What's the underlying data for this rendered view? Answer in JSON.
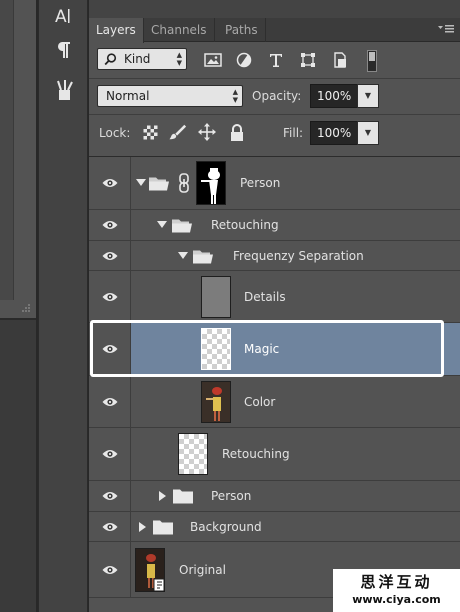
{
  "tabs": [
    {
      "label": "Layers",
      "active": true
    },
    {
      "label": "Channels",
      "active": false
    },
    {
      "label": "Paths",
      "active": false
    }
  ],
  "filter": {
    "kind_label": "Kind"
  },
  "blend": {
    "mode": "Normal",
    "opacity_label": "Opacity:",
    "opacity_value": "100%",
    "fill_label": "Fill:",
    "fill_value": "100%",
    "lock_label": "Lock:"
  },
  "layers": [
    {
      "name": "Person",
      "type": "group-masked",
      "expanded": true
    },
    {
      "name": "Retouching",
      "type": "group",
      "expanded": true
    },
    {
      "name": "Frequenzy Separation",
      "type": "group",
      "expanded": true
    },
    {
      "name": "Details",
      "type": "layer"
    },
    {
      "name": "Magic",
      "type": "layer",
      "selected": true
    },
    {
      "name": "Color",
      "type": "layer"
    },
    {
      "name": "Retouching",
      "type": "layer"
    },
    {
      "name": "Person",
      "type": "group",
      "expanded": false
    },
    {
      "name": "Background",
      "type": "group",
      "expanded": false
    },
    {
      "name": "Original",
      "type": "layer"
    }
  ],
  "colors": {
    "panel_bg": "#535353",
    "selected_row": "#6f849e",
    "highlight_outline": "#ffffff"
  },
  "watermark": {
    "title": "思洋互动",
    "url": "www.ciya.com"
  }
}
